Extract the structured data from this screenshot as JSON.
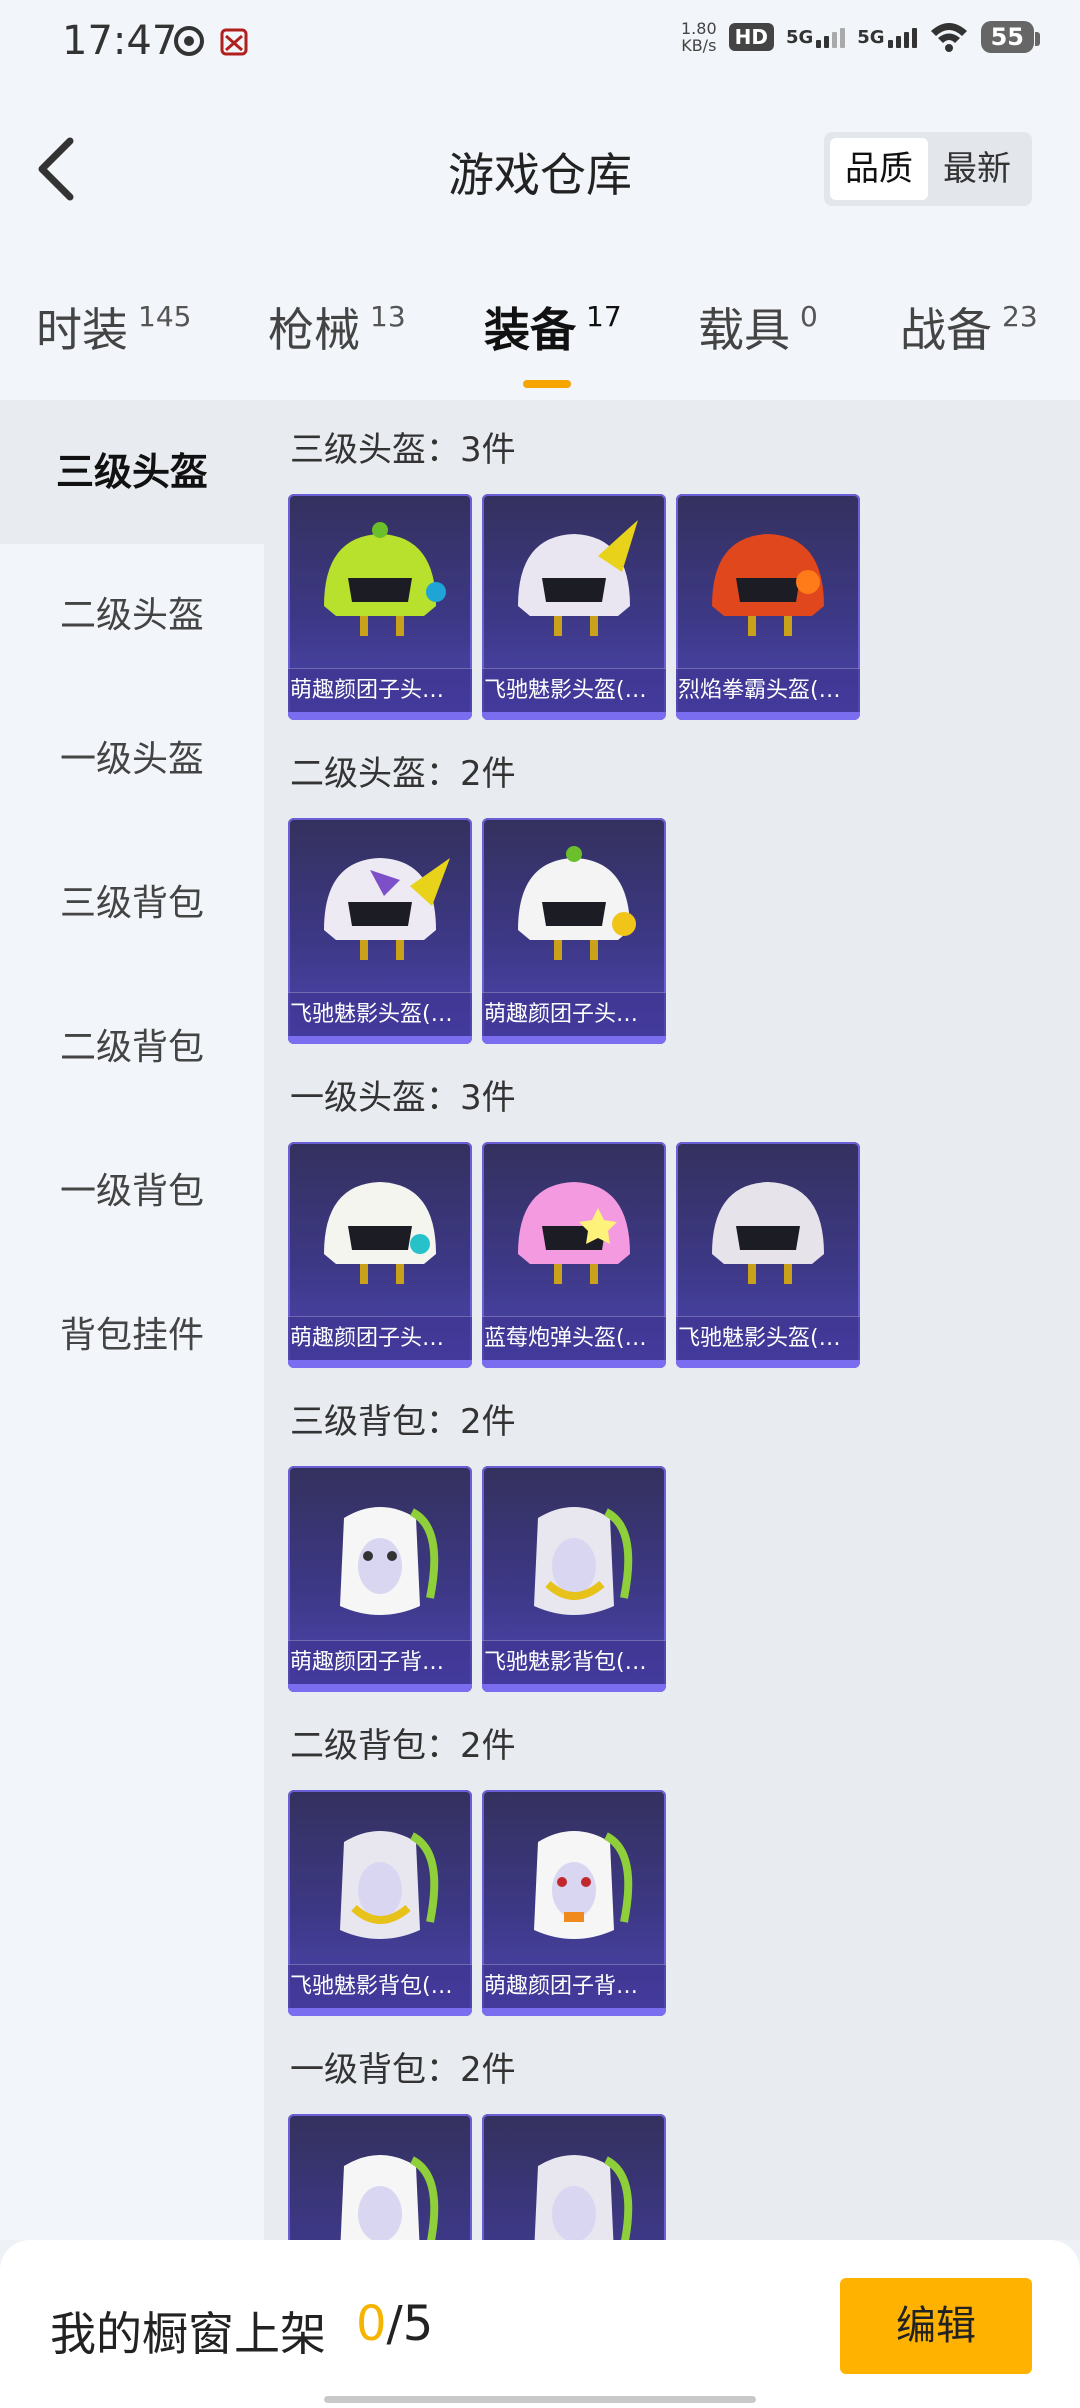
{
  "status_bar": {
    "time": "17:47",
    "net_speed_value": "1.80",
    "net_speed_unit": "KB/s",
    "hd_label": "HD",
    "sim1_label": "5G",
    "sim2_label": "5G",
    "battery": "55"
  },
  "header": {
    "title": "游戏仓库",
    "sort_options": [
      "品质",
      "最新"
    ],
    "sort_selected": "品质"
  },
  "tabs": [
    {
      "label": "时装",
      "count": "145"
    },
    {
      "label": "枪械",
      "count": "13"
    },
    {
      "label": "装备",
      "count": "17"
    },
    {
      "label": "载具",
      "count": "0"
    },
    {
      "label": "战备",
      "count": "23"
    }
  ],
  "active_tab": "装备",
  "sidebar": {
    "items": [
      "三级头盔",
      "二级头盔",
      "一级头盔",
      "三级背包",
      "二级背包",
      "一级背包",
      "背包挂件"
    ],
    "active": "三级头盔"
  },
  "sections": [
    {
      "title": "三级头盔：3件",
      "items": [
        "萌趣颜团子头…",
        "飞驰魅影头盔(…",
        "烈焰拳霸头盔(…"
      ]
    },
    {
      "title": "二级头盔：2件",
      "items": [
        "飞驰魅影头盔(…",
        "萌趣颜团子头…"
      ]
    },
    {
      "title": "一级头盔：3件",
      "items": [
        "萌趣颜团子头…",
        "蓝莓炮弹头盔(…",
        "飞驰魅影头盔(…"
      ]
    },
    {
      "title": "三级背包：2件",
      "items": [
        "萌趣颜团子背…",
        "飞驰魅影背包(…"
      ]
    },
    {
      "title": "二级背包：2件",
      "items": [
        "飞驰魅影背包(…",
        "萌趣颜团子背…"
      ]
    },
    {
      "title": "一级背包：2件",
      "items": [
        "",
        ""
      ]
    }
  ],
  "bottom_bar": {
    "shelf_label": "我的橱窗上架",
    "shelf_current": "0",
    "shelf_total": "/5",
    "edit_label": "编辑"
  },
  "colors": {
    "accent": "#f5a400",
    "edit_button": "#ffb300",
    "card_bg": "#3d3886"
  }
}
